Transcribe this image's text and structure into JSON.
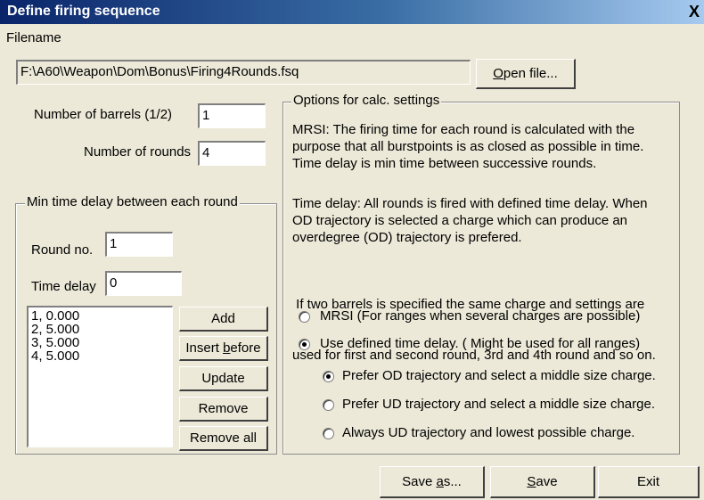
{
  "window": {
    "title": "Define firing sequence",
    "close_glyph": "X"
  },
  "file": {
    "label": "Filename",
    "path": "F:\\A60\\Weapon\\Dom\\Bonus\\Firing4Rounds.fsq",
    "open_button": {
      "pre": "",
      "ul": "O",
      "post": "pen file..."
    }
  },
  "barrels": {
    "label": "Number of barrels (1/2)",
    "value": "1"
  },
  "rounds": {
    "label": "Number of rounds",
    "value": "4"
  },
  "delay_group": {
    "legend": "Min time delay between each round",
    "round_no_label": "Round no.",
    "round_no_value": "1",
    "time_delay_label": "Time delay",
    "time_delay_value": "0",
    "list": [
      "1, 0.000",
      "2, 5.000",
      "3, 5.000",
      "4, 5.000"
    ],
    "buttons": {
      "add": "Add",
      "insert": {
        "pre": "Insert ",
        "ul": "b",
        "post": "efore"
      },
      "update": "Update",
      "remove": "Remove",
      "remove_all": "Remove all"
    }
  },
  "options": {
    "legend": "Options for calc. settings",
    "mrsi_desc": [
      "MRSI: The firing time for each round is calculated with the",
      "purpose that all burstpoints is as closed as possible in time.",
      "Time delay  is min time between successive rounds."
    ],
    "delay_desc": [
      "Time delay: All rounds is fired with defined time delay. When",
      "OD trajectory is selected a charge which can produce an",
      "overdegree (OD) trajectory is prefered."
    ],
    "barrels_desc": [
      " If two barrels is specified the same charge and settings are",
      "used for first and second round, 3rd and 4th round and so on."
    ],
    "radio_main": [
      {
        "label": "MRSI (For ranges when several charges are possible)",
        "checked": false
      },
      {
        "label": "Use defined time delay. ( Might be used for all ranges)",
        "checked": true
      }
    ],
    "radio_sub": [
      {
        "label": "Prefer OD trajectory and select a middle size charge.",
        "checked": true
      },
      {
        "label": "Prefer UD trajectory and select a middle size charge.",
        "checked": false
      },
      {
        "label": "Always UD trajectory and lowest possible charge.",
        "checked": false
      }
    ]
  },
  "footer": {
    "save_as": {
      "pre": "Save ",
      "ul": "a",
      "post": "s..."
    },
    "save": {
      "pre": "",
      "ul": "S",
      "post": "ave"
    },
    "exit": "Exit"
  }
}
